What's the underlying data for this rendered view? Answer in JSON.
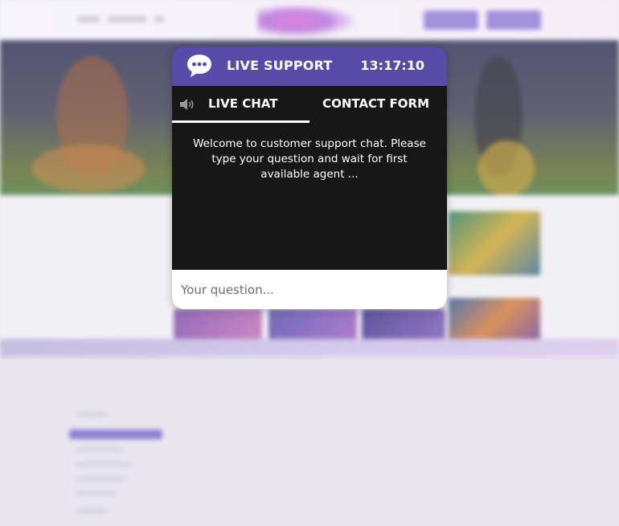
{
  "widget": {
    "title": "LIVE SUPPORT",
    "clock": "13:17:10",
    "tabs": {
      "live_chat": "LIVE CHAT",
      "contact_form": "CONTACT FORM"
    },
    "active_tab": "live_chat",
    "welcome_message": "Welcome to customer support chat. Please type your question and wait for first available agent ...",
    "input_placeholder": "Your question...",
    "input_value": "",
    "icons": {
      "header": "chat-bubble-icon",
      "tab": "speaker-icon"
    },
    "colors": {
      "header_bg": "#584aa7",
      "body_bg": "#171717",
      "text": "#ffffff",
      "input_bg": "#ffffff"
    }
  }
}
